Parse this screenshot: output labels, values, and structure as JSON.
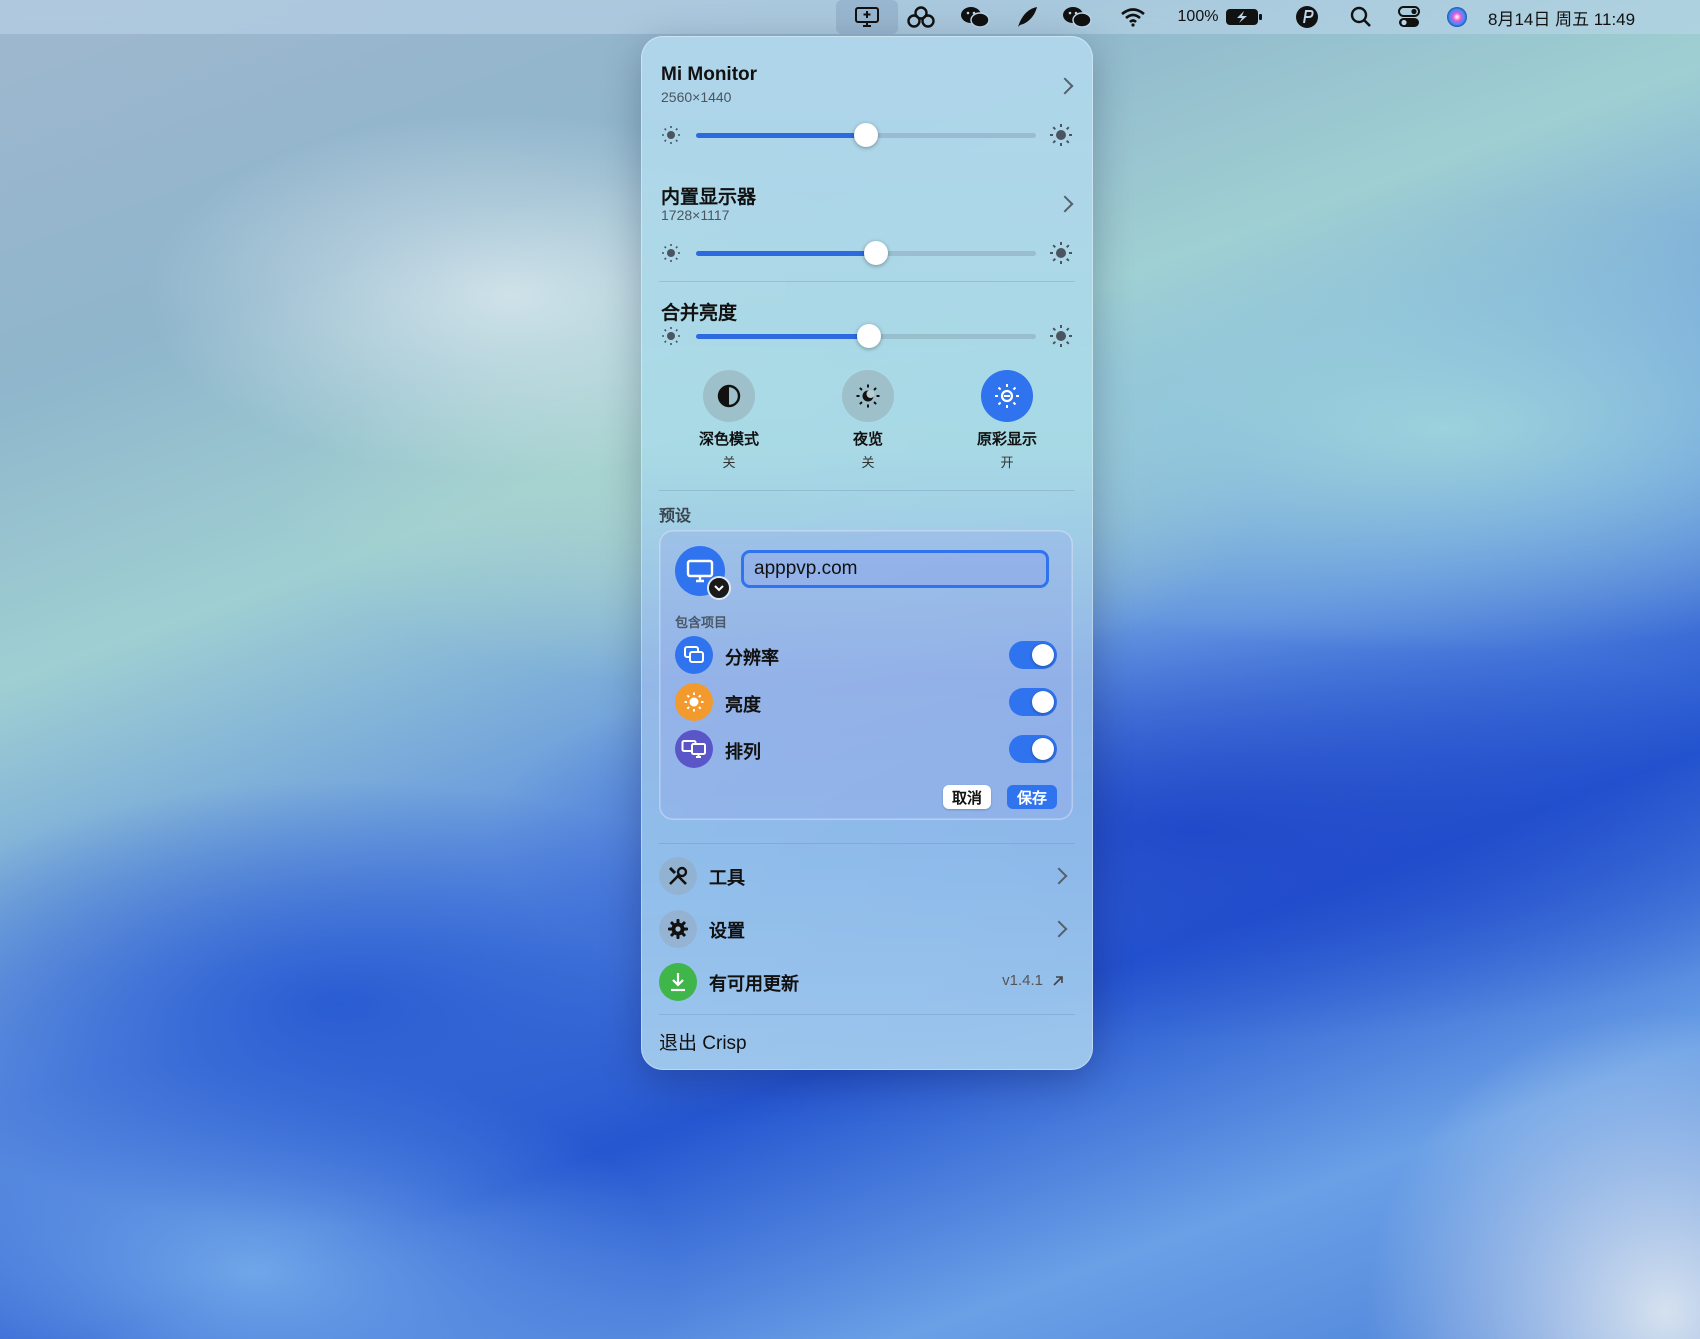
{
  "menubar": {
    "battery_text": "100%",
    "clock_text": "8月14日 周五  11:49",
    "icons": [
      "display-icon",
      "app-icon",
      "wechat-icon",
      "feather-icon",
      "wechat-icon",
      "wifi-icon",
      "battery-icon",
      "app-icon",
      "search-icon",
      "control-center-icon",
      "siri-icon"
    ]
  },
  "displays": [
    {
      "name": "Mi Monitor",
      "resolution": "2560×1440",
      "brightness": 0.5
    },
    {
      "name": "内置显示器",
      "resolution": "1728×1117",
      "brightness": 0.53
    }
  ],
  "combined": {
    "label": "合并亮度",
    "brightness": 0.51
  },
  "quick_toggles": [
    {
      "label": "深色模式",
      "state": "关",
      "icon": "contrast-icon",
      "on": false
    },
    {
      "label": "夜览",
      "state": "关",
      "icon": "night-shift-icon",
      "on": false
    },
    {
      "label": "原彩显示",
      "state": "开",
      "icon": "true-tone-icon",
      "on": true
    }
  ],
  "presets": {
    "section_label": "预设",
    "name_value": "apppvp.com",
    "included_label": "包含项目",
    "items": [
      {
        "label": "分辨率",
        "icon": "resolution-icon",
        "enabled": true,
        "color": "#2f73ee"
      },
      {
        "label": "亮度",
        "icon": "brightness-icon",
        "enabled": true,
        "color": "#f29a2e"
      },
      {
        "label": "排列",
        "icon": "arrangement-icon",
        "enabled": true,
        "color": "#5a56c8"
      }
    ],
    "cancel_label": "取消",
    "save_label": "保存"
  },
  "menu": {
    "tools_label": "工具",
    "settings_label": "设置",
    "update_label": "有可用更新",
    "update_version": "v1.4.1",
    "quit_label": "退出 Crisp"
  },
  "colors": {
    "accent": "#2f73ee",
    "update_green": "#3fb54a"
  }
}
